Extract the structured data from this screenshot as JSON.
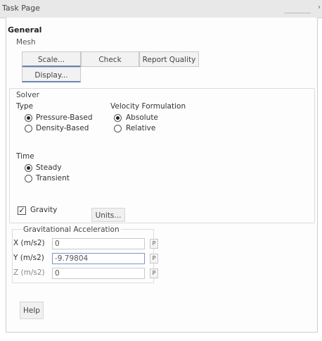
{
  "window": {
    "title": "Task Page",
    "pin_glyph": "›"
  },
  "general": {
    "heading": "General",
    "mesh": {
      "label": "Mesh",
      "buttons": {
        "scale": "Scale...",
        "check": "Check",
        "report_quality": "Report Quality",
        "display": "Display..."
      }
    },
    "solver": {
      "label": "Solver",
      "type": {
        "label": "Type",
        "options": [
          "Pressure-Based",
          "Density-Based"
        ],
        "selected": "Pressure-Based"
      },
      "velocity": {
        "label": "Velocity Formulation",
        "options": [
          "Absolute",
          "Relative"
        ],
        "selected": "Absolute"
      },
      "time": {
        "label": "Time",
        "options": [
          "Steady",
          "Transient"
        ],
        "selected": "Steady"
      }
    },
    "gravity": {
      "checkbox_label": "Gravity",
      "checked": true,
      "check_glyph": "✓",
      "units_button": "Units...",
      "group_label": "Gravitational Acceleration",
      "fields": [
        {
          "label": "X (m/s2)",
          "value": "0",
          "p": "P"
        },
        {
          "label": "Y (m/s2)",
          "value": "-9.79804",
          "p": "P"
        },
        {
          "label": "Z (m/s2)",
          "value": "0",
          "p": "P"
        }
      ]
    },
    "help_button": "Help"
  }
}
